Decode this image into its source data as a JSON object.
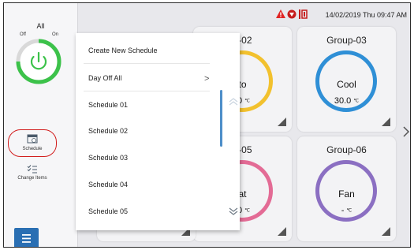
{
  "sidebar": {
    "all_label": "All",
    "off_label": "Off",
    "on_label": "On",
    "schedule_label": "Schedule",
    "change_items_label": "Change Items"
  },
  "header": {
    "datetime": "14/02/2019 Thu 09:47 AM",
    "icons": [
      "warning-icon",
      "service-icon",
      "filter-icon"
    ]
  },
  "groups": [
    {
      "title": "p-02",
      "mode": "to",
      "temp": ".0",
      "unit": "℃",
      "ring_color": "#f2c12e"
    },
    {
      "title": "Group-03",
      "mode": "Cool",
      "temp": "30.0",
      "unit": "℃",
      "ring_color": "#2f8fd6"
    },
    {
      "title": "p-05",
      "mode": "at",
      "temp": ".0",
      "unit": "℃",
      "ring_color": "#e36b95"
    },
    {
      "title": "Group-06",
      "mode": "Fan",
      "temp": "-",
      "unit": "℃",
      "ring_color": "#8b6fc2"
    }
  ],
  "dropdown": {
    "items": [
      "Create New Schedule",
      "Day Off All",
      "Schedule 01",
      "Schedule 02",
      "Schedule 03",
      "Schedule 04",
      "Schedule 05"
    ],
    "submenu_chevron": ">"
  },
  "colors": {
    "accent_blue": "#2a6fb3",
    "power_green": "#3cc24a",
    "highlight_red": "#d21e1e"
  }
}
